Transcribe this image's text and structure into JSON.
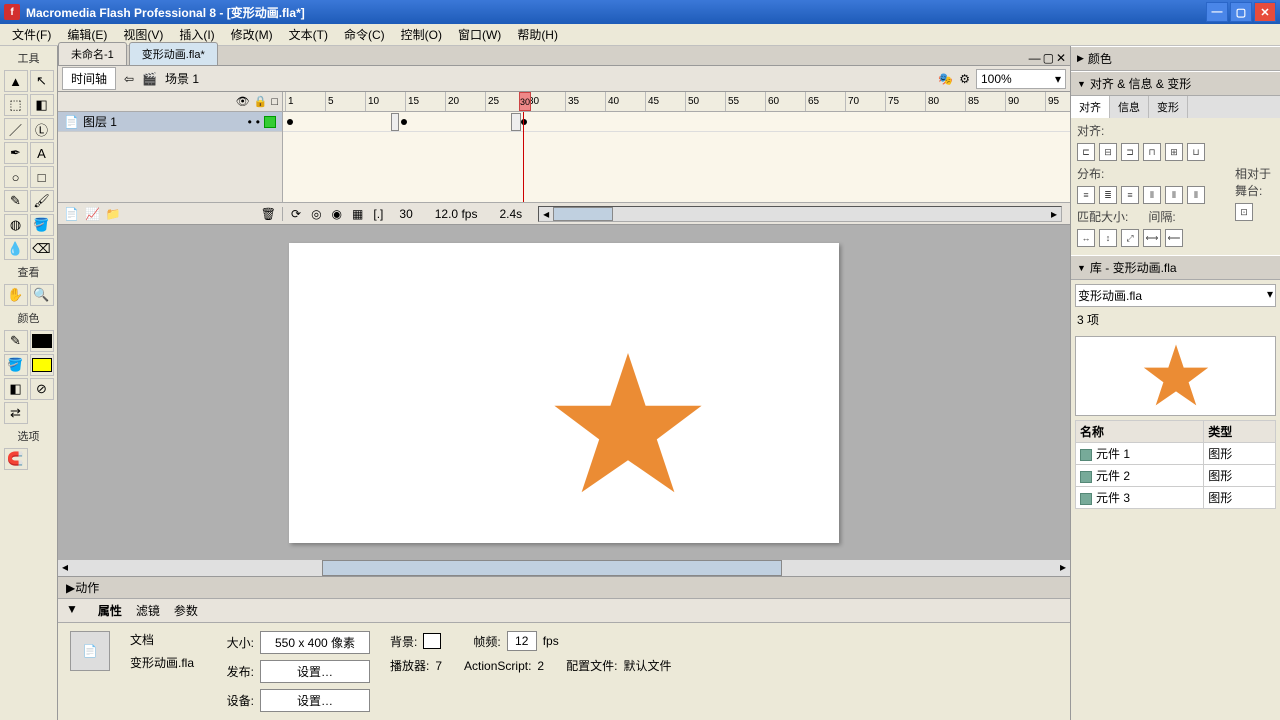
{
  "titlebar": {
    "app_icon": "f",
    "text": "Macromedia Flash Professional 8 - [变形动画.fla*]"
  },
  "menu": {
    "file": "文件(F)",
    "edit": "编辑(E)",
    "view": "视图(V)",
    "insert": "插入(I)",
    "modify": "修改(M)",
    "text": "文本(T)",
    "commands": "命令(C)",
    "control": "控制(O)",
    "window": "窗口(W)",
    "help": "帮助(H)"
  },
  "doc_tabs": {
    "tab1": "未命名-1",
    "tab2": "变形动画.fla*"
  },
  "scene_bar": {
    "timeline_btn": "时间轴",
    "scene_label": "场景 1",
    "zoom": "100%"
  },
  "timeline": {
    "layer_name": "图层 1",
    "ruler_marks": [
      "1",
      "5",
      "10",
      "15",
      "20",
      "25",
      "30",
      "35",
      "40",
      "45",
      "50",
      "55",
      "60",
      "65",
      "70",
      "75",
      "80",
      "85",
      "90",
      "95"
    ],
    "playhead_frame": "30",
    "footer_frame": "30",
    "footer_fps": "12.0 fps",
    "footer_time": "2.4s"
  },
  "tools_panel": {
    "title_tools": "工具",
    "title_view": "查看",
    "title_color": "颜色",
    "title_options": "选项"
  },
  "actions_panel": {
    "header": "动作"
  },
  "props_panel": {
    "tab_props": "属性",
    "tab_filters": "滤镜",
    "tab_params": "参数",
    "doc_label": "文档",
    "doc_name": "变形动画.fla",
    "size_label": "大小:",
    "size_value": "550 x 400 像素",
    "bg_label": "背景:",
    "fps_label": "帧频:",
    "fps_value": "12",
    "fps_unit": "fps",
    "publish_label": "发布:",
    "publish_btn": "设置…",
    "player_label": "播放器:",
    "player_value": "7",
    "as_label": "ActionScript:",
    "as_value": "2",
    "profile_label": "配置文件:",
    "profile_value": "默认文件",
    "device_label": "设备:",
    "device_btn": "设置…"
  },
  "right": {
    "color_head": "颜色",
    "align_head": "对齐 & 信息 & 变形",
    "align_tab1": "对齐",
    "align_tab2": "信息",
    "align_tab3": "变形",
    "align_label": "对齐:",
    "distrib_label": "分布:",
    "match_label": "匹配大小:",
    "space_label": "间隔:",
    "relative_label": "相对于舞台:",
    "lib_head": "库 - 变形动画.fla",
    "lib_select": "变形动画.fla",
    "lib_count": "3 项",
    "lib_col_name": "名称",
    "lib_col_type": "类型",
    "lib_items": [
      {
        "name": "元件 1",
        "type": "图形"
      },
      {
        "name": "元件 2",
        "type": "图形"
      },
      {
        "name": "元件 3",
        "type": "图形"
      }
    ]
  }
}
